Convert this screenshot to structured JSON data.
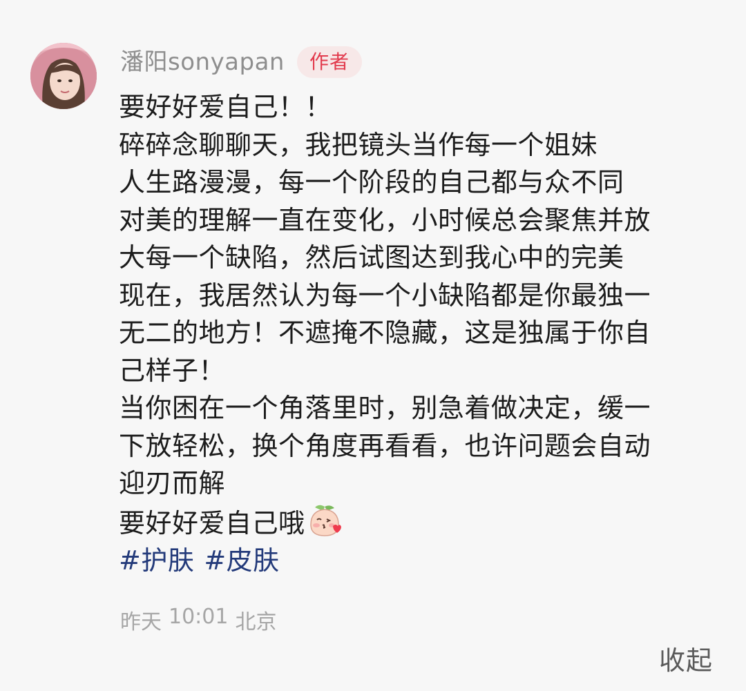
{
  "author": {
    "name": "潘阳sonyapan",
    "badge": "作者"
  },
  "post": {
    "lines": [
      "要好好爱自己！！",
      "碎碎念聊聊天，我把镜头当作每一个姐妹",
      "人生路漫漫，每一个阶段的自己都与众不同",
      "对美的理解一直在变化，小时候总会聚焦并放",
      "大每一个缺陷，然后试图达到我心中的完美",
      "现在，我居然认为每一个小缺陷都是你最独一",
      "无二的地方！不遮掩不隐藏，这是独属于你自",
      "己样子！",
      "当你困在一个角落里时，别急着做决定，缓一",
      "下放轻松，换个角度再看看，也许问题会自动",
      "迎刃而解",
      "要好好爱自己哦"
    ],
    "emoji": "peach-kiss-emoji",
    "tags": [
      "#护肤",
      "#皮肤"
    ]
  },
  "meta": {
    "date": "昨天",
    "time": "10:01",
    "location": "北京"
  },
  "collapse_label": "收起",
  "colors": {
    "tag": "#233a7a",
    "badge_text": "#e23a4d",
    "badge_bg": "#f7e8e8"
  }
}
